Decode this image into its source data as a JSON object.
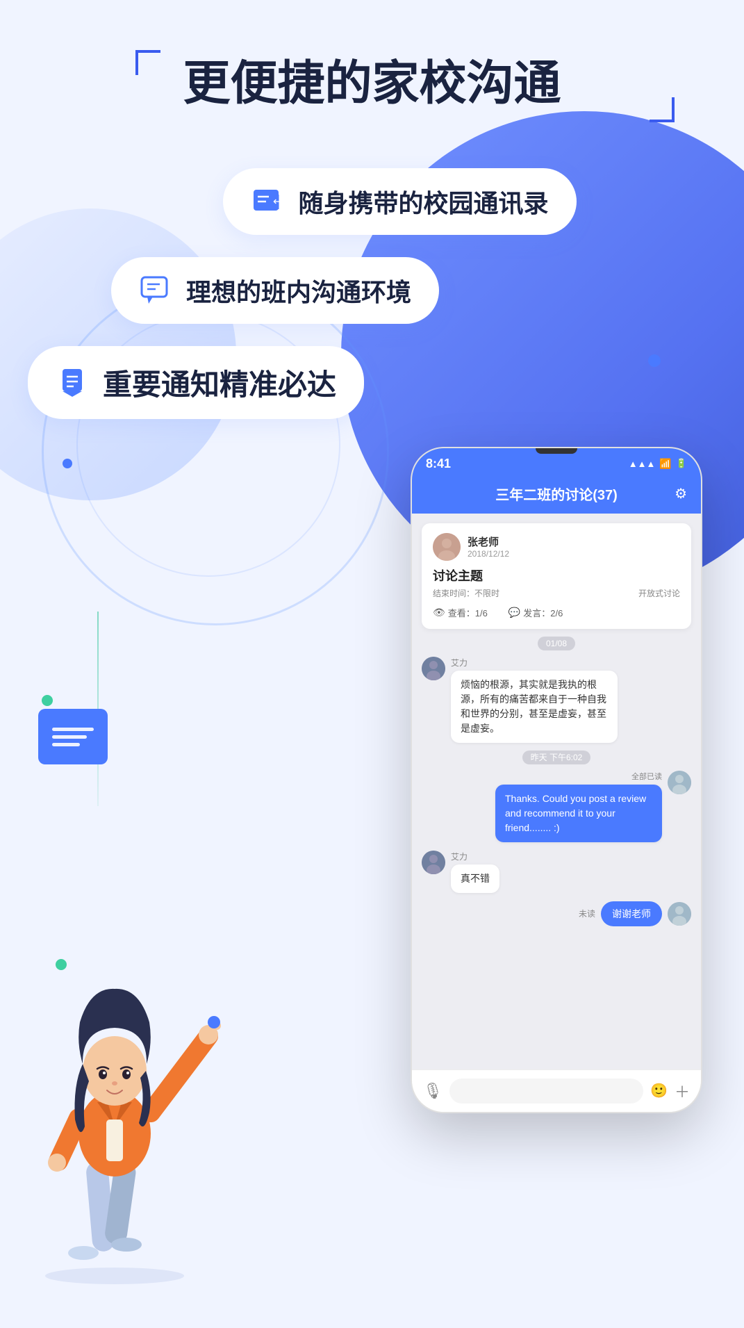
{
  "page": {
    "bg": "#f0f4ff",
    "accent": "#4a7aff"
  },
  "title": "更便捷的家校沟通",
  "features": [
    {
      "id": "contact",
      "icon": "contact-icon",
      "text": "随身携带的校园通讯录"
    },
    {
      "id": "chat",
      "icon": "chat-icon",
      "text": "理想的班内沟通环境"
    },
    {
      "id": "notify",
      "icon": "notify-icon",
      "text": "重要通知精准必达"
    }
  ],
  "phone": {
    "status_time": "8:41",
    "chat_title": "三年二班的讨论(37)",
    "discussion": {
      "teacher_name": "张老师",
      "teacher_date": "2018/12/12",
      "topic": "讨论主题",
      "end_time": "结束时间：不限时",
      "type": "开放式讨论",
      "views": "查看：1/6",
      "posts": "发言：2/6"
    },
    "date_sep1": "01/08",
    "messages": [
      {
        "sender": "艾力",
        "side": "left",
        "text": "烦恼的根源，其实就是我执的根源，所有的痛苦都来自于一种自我和世界的分别，甚至是虚妄，甚至是虚妄。",
        "time": ""
      },
      {
        "sender": "me",
        "side": "right",
        "time": "昨天 下午6:02",
        "text": "Thanks. Could you post a review and recommend it to your friend........  :)",
        "read_label": "全部已读"
      },
      {
        "sender": "艾力",
        "side": "left",
        "text": "真不错",
        "time": ""
      }
    ],
    "unread_label": "未读",
    "unread_msg": "谢谢老师",
    "input_placeholder": ""
  }
}
